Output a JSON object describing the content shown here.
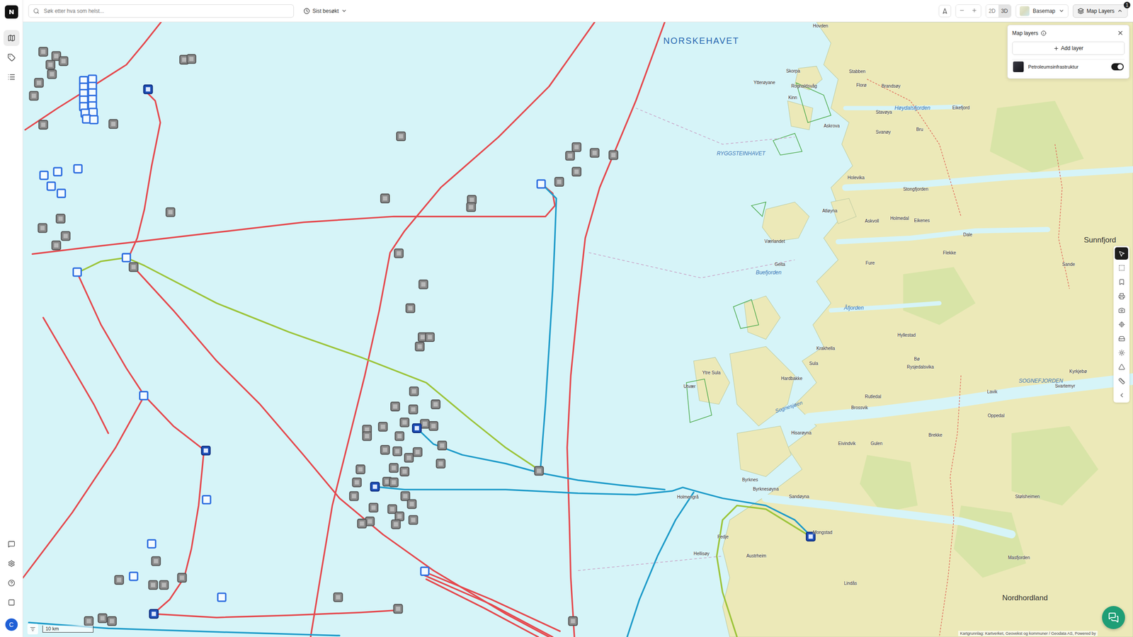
{
  "sidebar": {
    "items": [
      {
        "selected": true
      },
      {
        "selected": false
      },
      {
        "selected": false
      }
    ],
    "avatar": "C"
  },
  "topbar": {
    "search": {
      "placeholder": "Søk etter hva som helst..."
    },
    "recent": "Sist besøkt",
    "view_modes": [
      {
        "label": "2D",
        "selected": false
      },
      {
        "label": "3D",
        "selected": true
      }
    ],
    "basemap": "Basemap",
    "map_layers_button": {
      "label": "Map Layers",
      "badge": "1",
      "expanded": true
    }
  },
  "layers_panel": {
    "title": "Map layers",
    "add_label": "Add layer",
    "layers": [
      {
        "name": "Petroleumsinfrastruktur",
        "on": true
      }
    ]
  },
  "tools": [
    {
      "selected": true
    },
    {
      "selected": false
    },
    {
      "selected": false
    },
    {
      "selected": false
    },
    {
      "selected": false
    },
    {
      "selected": false
    },
    {
      "selected": false
    },
    {
      "selected": false
    },
    {
      "selected": false
    },
    {
      "selected": false
    },
    {
      "selected": false
    }
  ],
  "map": {
    "labels": [
      {
        "text": "NORSKEHAVET",
        "kind": "sea"
      },
      {
        "text": "RYGGSTEINHAVET",
        "kind": "bay"
      },
      {
        "text": "Buefjorden",
        "kind": "bay"
      },
      {
        "text": "Åfjorden",
        "kind": "bay"
      },
      {
        "text": "Sognesjøen",
        "kind": "tilted"
      },
      {
        "text": "SOGNEFJORDEN",
        "kind": "bay"
      },
      {
        "text": "Nordhordland",
        "kind": "region"
      },
      {
        "text": "Sunnfjord",
        "kind": "region"
      },
      {
        "text": "Hovden",
        "kind": "place"
      },
      {
        "text": "Skorpa",
        "kind": "place"
      },
      {
        "text": "Stabben",
        "kind": "place"
      },
      {
        "text": "Rognaldsvåg",
        "kind": "place"
      },
      {
        "text": "Kinn",
        "kind": "place"
      },
      {
        "text": "Ytterøyane",
        "kind": "place"
      },
      {
        "text": "Florø",
        "kind": "place"
      },
      {
        "text": "Brandsøy",
        "kind": "place"
      },
      {
        "text": "Høydalsfjorden",
        "kind": "bay"
      },
      {
        "text": "Eikefjord",
        "kind": "place"
      },
      {
        "text": "Askrova",
        "kind": "place"
      },
      {
        "text": "Svanøy",
        "kind": "place"
      },
      {
        "text": "Stavøya",
        "kind": "place"
      },
      {
        "text": "Bru",
        "kind": "place"
      },
      {
        "text": "Holevika",
        "kind": "place"
      },
      {
        "text": "Stongfjorden",
        "kind": "place"
      },
      {
        "text": "Atløyna",
        "kind": "place"
      },
      {
        "text": "Askvoll",
        "kind": "place"
      },
      {
        "text": "Holmedal",
        "kind": "place"
      },
      {
        "text": "Eikenes",
        "kind": "place"
      },
      {
        "text": "Værlandet",
        "kind": "place"
      },
      {
        "text": "Geita",
        "kind": "place"
      },
      {
        "text": "Dale",
        "kind": "place"
      },
      {
        "text": "Fure",
        "kind": "place"
      },
      {
        "text": "Flekke",
        "kind": "place"
      },
      {
        "text": "Hyllestad",
        "kind": "place"
      },
      {
        "text": "Krakhella",
        "kind": "place"
      },
      {
        "text": "Sula",
        "kind": "place"
      },
      {
        "text": "Hardbakke",
        "kind": "place"
      },
      {
        "text": "Ytre Sula",
        "kind": "place"
      },
      {
        "text": "Utvær",
        "kind": "place"
      },
      {
        "text": "Bø",
        "kind": "place"
      },
      {
        "text": "Rysjedalsvika",
        "kind": "place"
      },
      {
        "text": "Rutledal",
        "kind": "place"
      },
      {
        "text": "Brossvik",
        "kind": "place"
      },
      {
        "text": "Gulen",
        "kind": "place"
      },
      {
        "text": "Eivindvik",
        "kind": "place"
      },
      {
        "text": "Lavik",
        "kind": "place"
      },
      {
        "text": "Brekke",
        "kind": "place"
      },
      {
        "text": "Byrknes",
        "kind": "place"
      },
      {
        "text": "Byrknesøyna",
        "kind": "place"
      },
      {
        "text": "Sandøyna",
        "kind": "place"
      },
      {
        "text": "Holmengrå",
        "kind": "place"
      },
      {
        "text": "Fedje",
        "kind": "place"
      },
      {
        "text": "Hellisøy",
        "kind": "place"
      },
      {
        "text": "Austrheim",
        "kind": "place"
      },
      {
        "text": "Mongstad",
        "kind": "place"
      },
      {
        "text": "Lindås",
        "kind": "place"
      },
      {
        "text": "Stølsheimen",
        "kind": "place"
      },
      {
        "text": "Oppedal",
        "kind": "place"
      },
      {
        "text": "Hisarøyna",
        "kind": "place"
      },
      {
        "text": "Sande",
        "kind": "place"
      },
      {
        "text": "Kyrkjebø",
        "kind": "place"
      },
      {
        "text": "Svartemyr",
        "kind": "place"
      },
      {
        "text": "Masfjorden",
        "kind": "place"
      }
    ],
    "pipelines": [
      {
        "color": "#e5484d"
      },
      {
        "color": "#e5484d"
      },
      {
        "color": "#e5484d"
      },
      {
        "color": "#e5484d"
      },
      {
        "color": "#e5484d"
      },
      {
        "color": "#e5484d"
      },
      {
        "color": "#e5484d"
      },
      {
        "color": "#e5484d"
      },
      {
        "color": "#e5484d"
      },
      {
        "color": "#e5484d"
      },
      {
        "color": "#e5484d"
      },
      {
        "color": "#e5484d"
      },
      {
        "color": "#e5484d"
      },
      {
        "color": "#e5484d"
      },
      {
        "color": "#9cc43a"
      },
      {
        "color": "#9cc43a"
      },
      {
        "color": "#1e9bc9"
      },
      {
        "color": "#1e9bc9"
      },
      {
        "color": "#1e9bc9"
      },
      {
        "color": "#1e9bc9"
      },
      {
        "color": "#1e9bc9"
      }
    ],
    "installation_groups": [
      {
        "kind": "filled",
        "color": "#8a8a8a"
      },
      {
        "kind": "outlined",
        "color": "#2f6fe0"
      },
      {
        "kind": "solid",
        "color": "#1d4fb8"
      }
    ],
    "scale": "10 km",
    "attribution": "Kartgrunnlag: Kartverket, Geovekst og kommuner / Geodata AS, Powered by"
  }
}
